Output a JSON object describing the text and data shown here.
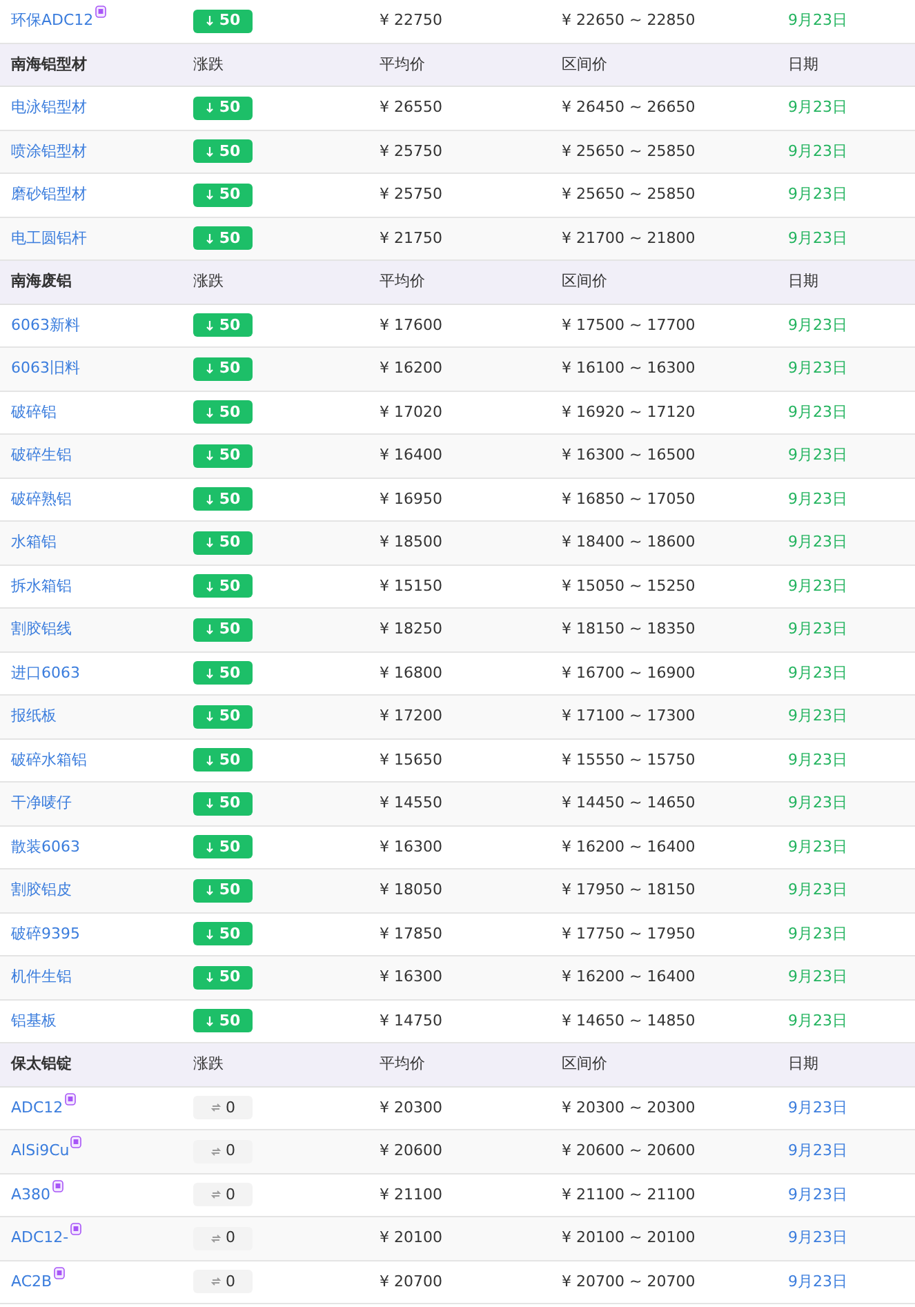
{
  "sections": [
    {
      "rows": [
        {
          "name": "环保ADC12",
          "tagged": true,
          "kind": "down",
          "change": "50",
          "avg": "¥ 22750",
          "range": "¥ 22650 ~ 22850",
          "date": "9月23日"
        }
      ]
    },
    {
      "header": [
        "南海铝型材",
        "涨跌",
        "平均价",
        "区间价",
        "日期"
      ],
      "rows": [
        {
          "name": "电泳铝型材",
          "tagged": false,
          "kind": "down",
          "change": "50",
          "avg": "¥ 26550",
          "range": "¥ 26450 ~ 26650",
          "date": "9月23日"
        },
        {
          "name": "喷涂铝型材",
          "tagged": false,
          "kind": "down",
          "change": "50",
          "avg": "¥ 25750",
          "range": "¥ 25650 ~ 25850",
          "date": "9月23日"
        },
        {
          "name": "磨砂铝型材",
          "tagged": false,
          "kind": "down",
          "change": "50",
          "avg": "¥ 25750",
          "range": "¥ 25650 ~ 25850",
          "date": "9月23日"
        },
        {
          "name": "电工圆铝杆",
          "tagged": false,
          "kind": "down",
          "change": "50",
          "avg": "¥ 21750",
          "range": "¥ 21700 ~ 21800",
          "date": "9月23日"
        }
      ]
    },
    {
      "header": [
        "南海废铝",
        "涨跌",
        "平均价",
        "区间价",
        "日期"
      ],
      "rows": [
        {
          "name": "6063新料",
          "tagged": false,
          "kind": "down",
          "change": "50",
          "avg": "¥ 17600",
          "range": "¥ 17500 ~ 17700",
          "date": "9月23日"
        },
        {
          "name": "6063旧料",
          "tagged": false,
          "kind": "down",
          "change": "50",
          "avg": "¥ 16200",
          "range": "¥ 16100 ~ 16300",
          "date": "9月23日"
        },
        {
          "name": "破碎铝",
          "tagged": false,
          "kind": "down",
          "change": "50",
          "avg": "¥ 17020",
          "range": "¥ 16920 ~ 17120",
          "date": "9月23日"
        },
        {
          "name": "破碎生铝",
          "tagged": false,
          "kind": "down",
          "change": "50",
          "avg": "¥ 16400",
          "range": "¥ 16300 ~ 16500",
          "date": "9月23日"
        },
        {
          "name": "破碎熟铝",
          "tagged": false,
          "kind": "down",
          "change": "50",
          "avg": "¥ 16950",
          "range": "¥ 16850 ~ 17050",
          "date": "9月23日"
        },
        {
          "name": "水箱铝",
          "tagged": false,
          "kind": "down",
          "change": "50",
          "avg": "¥ 18500",
          "range": "¥ 18400 ~ 18600",
          "date": "9月23日"
        },
        {
          "name": "拆水箱铝",
          "tagged": false,
          "kind": "down",
          "change": "50",
          "avg": "¥ 15150",
          "range": "¥ 15050 ~ 15250",
          "date": "9月23日"
        },
        {
          "name": "割胶铝线",
          "tagged": false,
          "kind": "down",
          "change": "50",
          "avg": "¥ 18250",
          "range": "¥ 18150 ~ 18350",
          "date": "9月23日"
        },
        {
          "name": "进口6063",
          "tagged": false,
          "kind": "down",
          "change": "50",
          "avg": "¥ 16800",
          "range": "¥ 16700 ~ 16900",
          "date": "9月23日"
        },
        {
          "name": "报纸板",
          "tagged": false,
          "kind": "down",
          "change": "50",
          "avg": "¥ 17200",
          "range": "¥ 17100 ~ 17300",
          "date": "9月23日"
        },
        {
          "name": "破碎水箱铝",
          "tagged": false,
          "kind": "down",
          "change": "50",
          "avg": "¥ 15650",
          "range": "¥ 15550 ~ 15750",
          "date": "9月23日"
        },
        {
          "name": "干净唛仔",
          "tagged": false,
          "kind": "down",
          "change": "50",
          "avg": "¥ 14550",
          "range": "¥ 14450 ~ 14650",
          "date": "9月23日"
        },
        {
          "name": "散装6063",
          "tagged": false,
          "kind": "down",
          "change": "50",
          "avg": "¥ 16300",
          "range": "¥ 16200 ~ 16400",
          "date": "9月23日"
        },
        {
          "name": "割胶铝皮",
          "tagged": false,
          "kind": "down",
          "change": "50",
          "avg": "¥ 18050",
          "range": "¥ 17950 ~ 18150",
          "date": "9月23日"
        },
        {
          "name": "破碎9395",
          "tagged": false,
          "kind": "down",
          "change": "50",
          "avg": "¥ 17850",
          "range": "¥ 17750 ~ 17950",
          "date": "9月23日"
        },
        {
          "name": "机件生铝",
          "tagged": false,
          "kind": "down",
          "change": "50",
          "avg": "¥ 16300",
          "range": "¥ 16200 ~ 16400",
          "date": "9月23日"
        },
        {
          "name": "铝基板",
          "tagged": false,
          "kind": "down",
          "change": "50",
          "avg": "¥ 14750",
          "range": "¥ 14650 ~ 14850",
          "date": "9月23日"
        }
      ]
    },
    {
      "header": [
        "保太铝锭",
        "涨跌",
        "平均价",
        "区间价",
        "日期"
      ],
      "rows": [
        {
          "name": "ADC12",
          "tagged": true,
          "kind": "flat",
          "change": "0",
          "avg": "¥ 20300",
          "range": "¥ 20300 ~ 20300",
          "date": "9月23日"
        },
        {
          "name": "AlSi9Cu",
          "tagged": true,
          "kind": "flat",
          "change": "0",
          "avg": "¥ 20600",
          "range": "¥ 20600 ~ 20600",
          "date": "9月23日"
        },
        {
          "name": "A380",
          "tagged": true,
          "kind": "flat",
          "change": "0",
          "avg": "¥ 21100",
          "range": "¥ 21100 ~ 21100",
          "date": "9月23日"
        },
        {
          "name": "ADC12-",
          "tagged": true,
          "kind": "flat",
          "change": "0",
          "avg": "¥ 20100",
          "range": "¥ 20100 ~ 20100",
          "date": "9月23日"
        },
        {
          "name": "AC2B",
          "tagged": true,
          "kind": "flat",
          "change": "0",
          "avg": "¥ 20700",
          "range": "¥ 20700 ~ 20700",
          "date": "9月23日"
        }
      ]
    }
  ]
}
